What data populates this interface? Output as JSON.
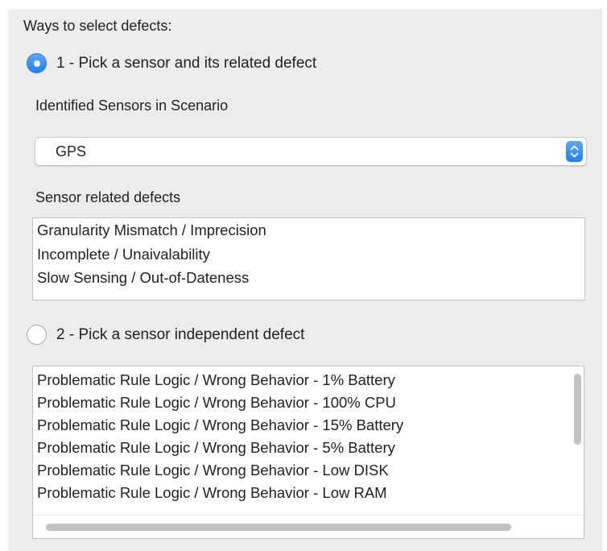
{
  "section_title": "Ways to select defects:",
  "option1": {
    "label": "1 - Pick a sensor and its related defect",
    "selected": true
  },
  "option2": {
    "label": "2 - Pick a sensor independent defect",
    "selected": false
  },
  "sensors_label": "Identified Sensors in Scenario",
  "sensor_select": {
    "value": "GPS"
  },
  "related_label": "Sensor related defects",
  "related_defects": [
    "Granularity Mismatch / Imprecision",
    "Incomplete / Unaivalability",
    "Slow Sensing / Out-of-Dateness"
  ],
  "independent_defects": [
    "Problematic Rule Logic / Wrong Behavior - 1% Battery",
    "Problematic Rule Logic / Wrong Behavior - 100% CPU",
    "Problematic Rule Logic / Wrong Behavior - 15% Battery",
    "Problematic Rule Logic / Wrong Behavior - 5% Battery",
    "Problematic Rule Logic / Wrong Behavior - Low DISK",
    "Problematic Rule Logic / Wrong Behavior - Low RAM"
  ],
  "colors": {
    "accent": "#1f7fef",
    "panel": "#ececec"
  }
}
